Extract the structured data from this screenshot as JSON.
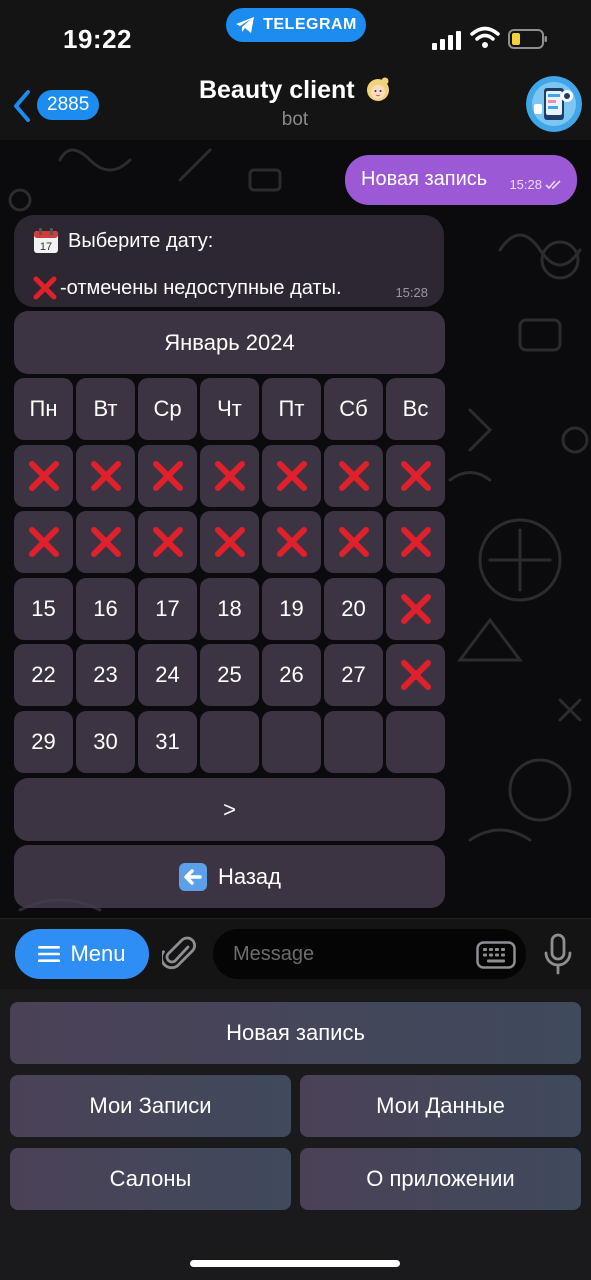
{
  "status_bar": {
    "time": "19:22",
    "app_pill": "TELEGRAM"
  },
  "header": {
    "back_count": "2885",
    "title": "Beauty client",
    "subtitle": "bot",
    "title_emoji": "woman-emoji",
    "avatar": "bot-avatar"
  },
  "chat": {
    "outgoing": {
      "text": "Новая запись",
      "time": "15:28"
    },
    "incoming": {
      "line1": "Выберите дату:",
      "line2": "-отмечены недоступные даты.",
      "time": "15:28",
      "line1_icon": "calendar-icon",
      "line2_icon": "cross-mark-icon"
    },
    "keyboard": {
      "month": "Январь 2024",
      "weekdays": [
        "Пн",
        "Вт",
        "Ср",
        "Чт",
        "Пт",
        "Сб",
        "Вс"
      ],
      "rows": [
        [
          "X",
          "X",
          "X",
          "X",
          "X",
          "X",
          "X"
        ],
        [
          "X",
          "X",
          "X",
          "X",
          "X",
          "X",
          "X"
        ],
        [
          "15",
          "16",
          "17",
          "18",
          "19",
          "20",
          "X"
        ],
        [
          "22",
          "23",
          "24",
          "25",
          "26",
          "27",
          "X"
        ],
        [
          "29",
          "30",
          "31",
          "",
          "",
          "",
          ""
        ]
      ],
      "next": ">",
      "back": "Назад"
    }
  },
  "input": {
    "menu": "Menu",
    "placeholder": "Message"
  },
  "reply_keyboard": {
    "new_booking": "Новая запись",
    "my_bookings": "Мои Записи",
    "my_data": "Мои Данные",
    "salons": "Салоны",
    "about": "О приложении"
  },
  "colors": {
    "accent_blue": "#2f8ef4",
    "outgoing_bubble": "#9b59d6",
    "incoming_bubble": "#2c2730",
    "unavailable_mark": "#e0202a"
  }
}
